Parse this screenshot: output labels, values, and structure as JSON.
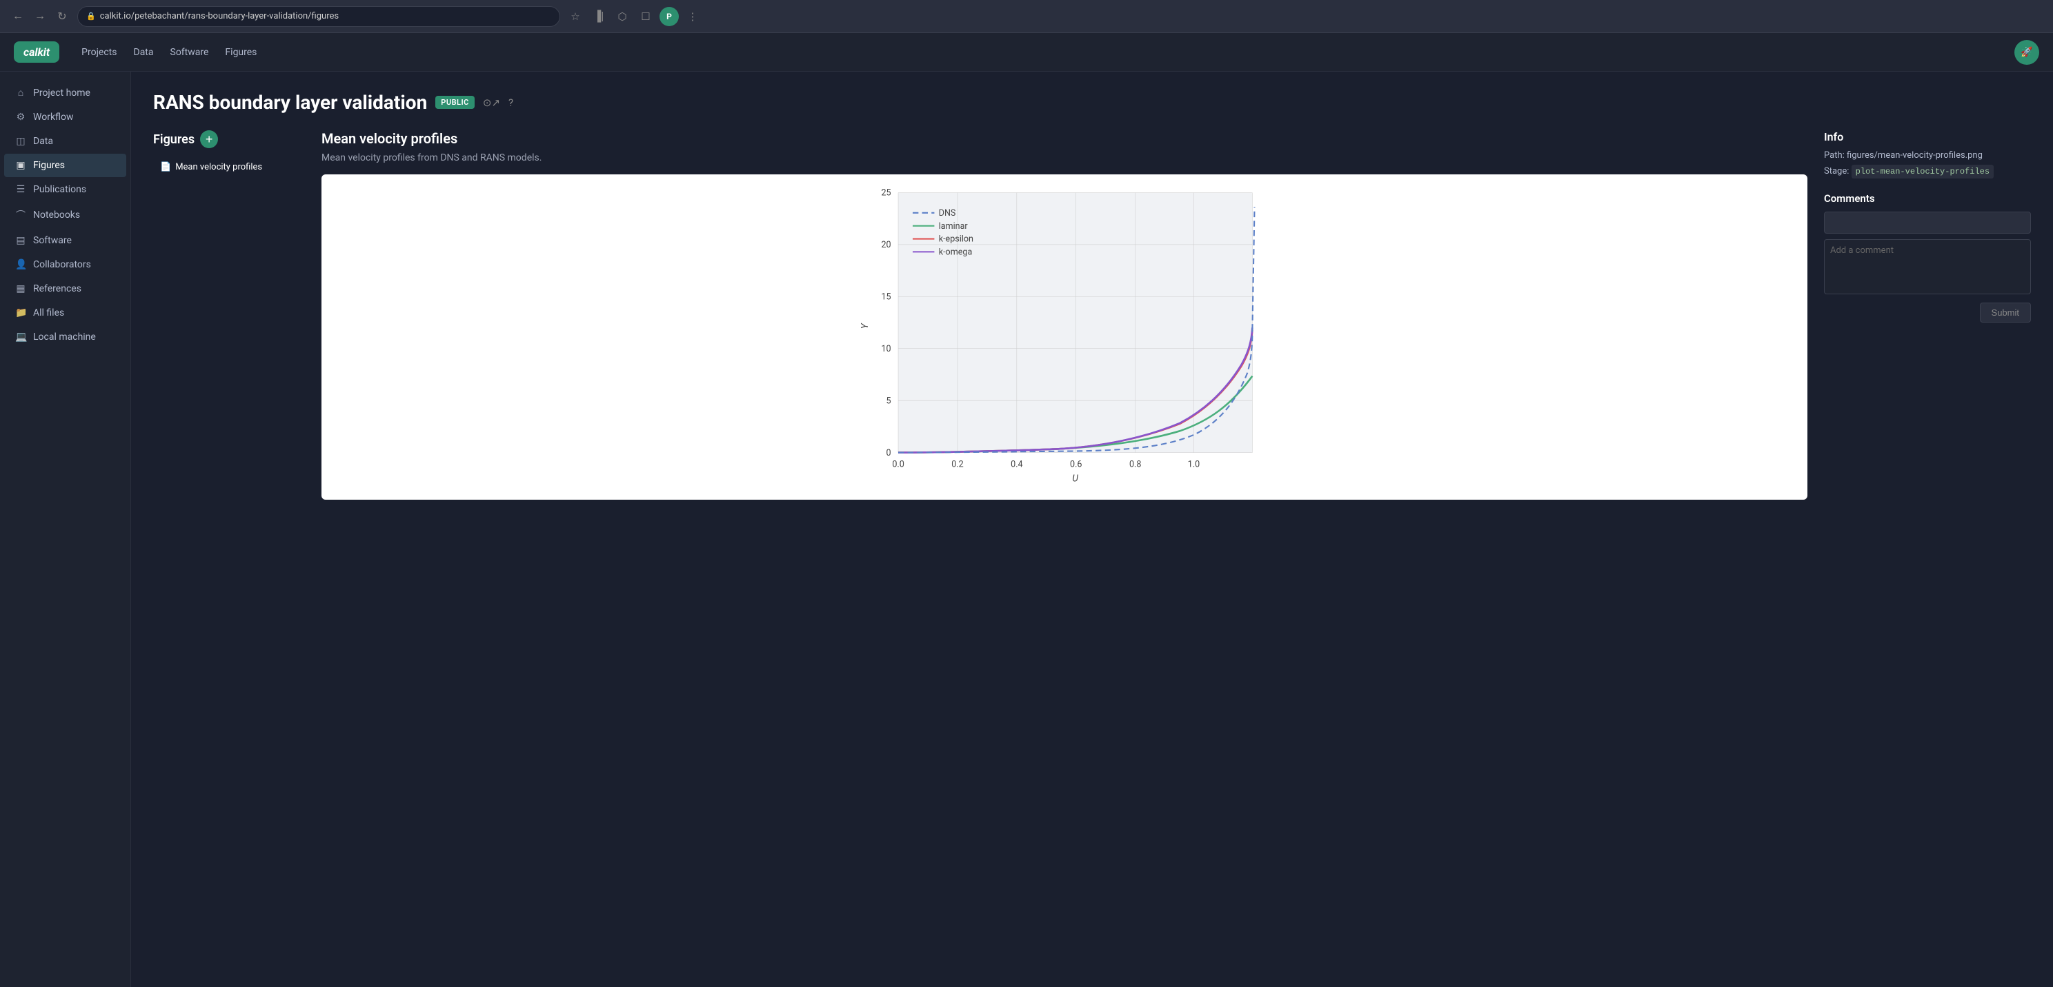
{
  "browser": {
    "back_btn": "←",
    "forward_btn": "→",
    "refresh_btn": "↻",
    "url": "calkit.io/petebachant/rans-boundary-layer-validation/figures",
    "star_icon": "★",
    "extensions": [
      "▐|",
      "⬡",
      "☐"
    ],
    "user_initial": "P",
    "menu_icon": "⋮"
  },
  "top_nav": {
    "logo": "calkit",
    "links": [
      "Projects",
      "Data",
      "Software",
      "Figures"
    ],
    "user_icon": "🚀"
  },
  "sidebar": {
    "items": [
      {
        "label": "Project home",
        "icon": "⌂",
        "id": "project-home"
      },
      {
        "label": "Workflow",
        "icon": "⚙",
        "id": "workflow"
      },
      {
        "label": "Data",
        "icon": "◫",
        "id": "data"
      },
      {
        "label": "Figures",
        "icon": "▣",
        "id": "figures",
        "active": true
      },
      {
        "label": "Publications",
        "icon": "☰",
        "id": "publications"
      },
      {
        "label": "Notebooks",
        "icon": "⌒",
        "id": "notebooks"
      },
      {
        "label": "Software",
        "icon": "▤",
        "id": "software"
      },
      {
        "label": "Collaborators",
        "icon": "👤",
        "id": "collaborators"
      },
      {
        "label": "References",
        "icon": "▦",
        "id": "references"
      },
      {
        "label": "All files",
        "icon": "📁",
        "id": "all-files"
      },
      {
        "label": "Local machine",
        "icon": "💻",
        "id": "local-machine"
      }
    ]
  },
  "project": {
    "title": "RANS boundary layer validation",
    "badge": "PUBLIC",
    "github_icon": "⊙",
    "external_link_icon": "↗",
    "help_icon": "?"
  },
  "figures_panel": {
    "title": "Figures",
    "add_icon": "+",
    "items": [
      {
        "label": "Mean velocity profiles",
        "icon": "📄",
        "active": true
      }
    ]
  },
  "figure_detail": {
    "name": "Mean velocity profiles",
    "description": "Mean velocity profiles from DNS and RANS models."
  },
  "chart": {
    "title": "Mean velocity profiles",
    "x_label": "U",
    "y_label": "Y",
    "legend": [
      {
        "label": "DNS",
        "color": "#5b7fc7",
        "style": "dashed"
      },
      {
        "label": "laminar",
        "color": "#4caf7d",
        "style": "solid"
      },
      {
        "label": "k-epsilon",
        "color": "#e05555",
        "style": "solid"
      },
      {
        "label": "k-omega",
        "color": "#8855cc",
        "style": "solid"
      }
    ],
    "x_ticks": [
      "0.0",
      "0.2",
      "0.4",
      "0.6",
      "0.8",
      "1.0"
    ],
    "y_ticks": [
      "0",
      "5",
      "10",
      "15",
      "20",
      "25"
    ]
  },
  "info_panel": {
    "title": "Info",
    "path_label": "Path:",
    "path_value": "figures/mean-velocity-profiles.png",
    "stage_label": "Stage:",
    "stage_value": "plot-mean-velocity-profiles",
    "comments_title": "Comments",
    "comment_placeholder": "Add a comment",
    "submit_label": "Submit"
  }
}
